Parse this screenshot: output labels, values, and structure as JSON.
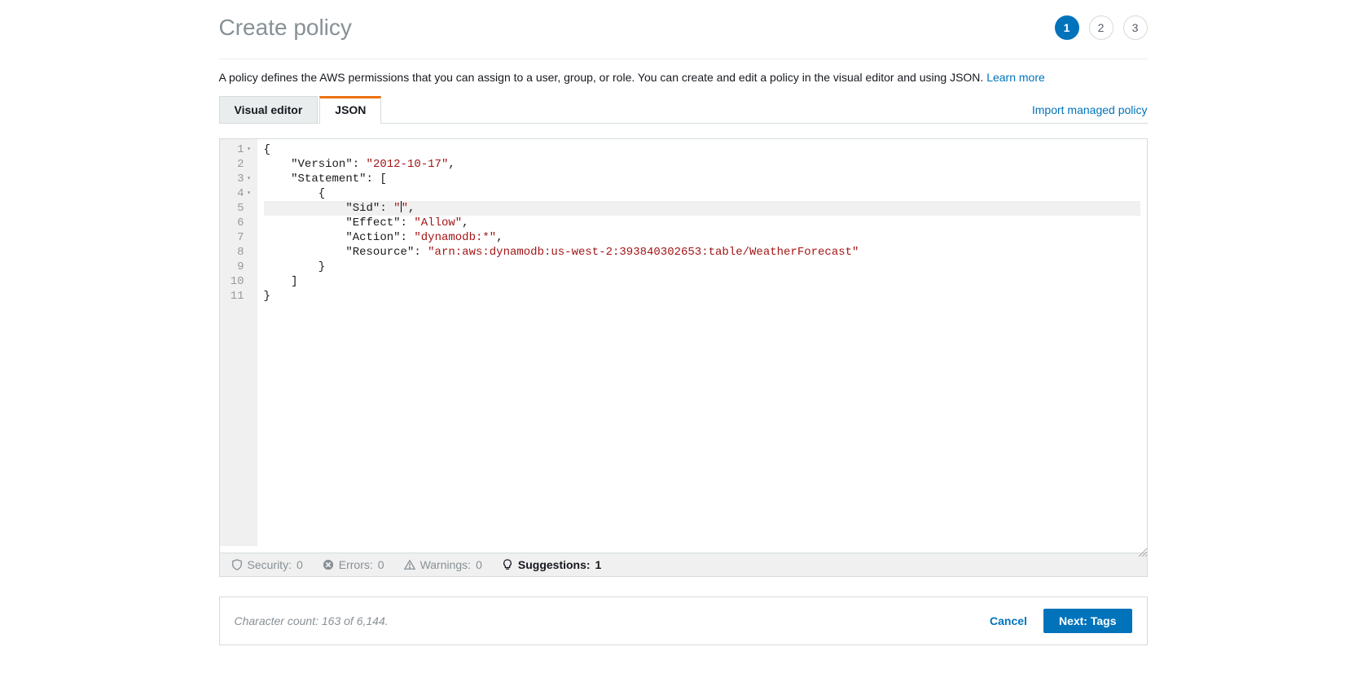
{
  "header": {
    "title": "Create policy",
    "steps": [
      "1",
      "2",
      "3"
    ],
    "active_step": 0
  },
  "description": {
    "text": "A policy defines the AWS permissions that you can assign to a user, group, or role. You can create and edit a policy in the visual editor and using JSON. ",
    "learn_more": "Learn more"
  },
  "tabs": {
    "visual": "Visual editor",
    "json": "JSON",
    "active": "json",
    "import_link": "Import managed policy"
  },
  "editor": {
    "line_numbers": [
      "1",
      "2",
      "3",
      "4",
      "5",
      "6",
      "7",
      "8",
      "9",
      "10",
      "11"
    ],
    "foldable": [
      0,
      2,
      3
    ],
    "highlighted_line": 4,
    "code_lines": [
      {
        "indent": 0,
        "tokens": [
          {
            "t": "{",
            "c": "punc"
          }
        ]
      },
      {
        "indent": 1,
        "tokens": [
          {
            "t": "\"Version\"",
            "c": "key"
          },
          {
            "t": ": ",
            "c": "punc"
          },
          {
            "t": "\"2012-10-17\"",
            "c": "str"
          },
          {
            "t": ",",
            "c": "punc"
          }
        ]
      },
      {
        "indent": 1,
        "tokens": [
          {
            "t": "\"Statement\"",
            "c": "key"
          },
          {
            "t": ": [",
            "c": "punc"
          }
        ]
      },
      {
        "indent": 2,
        "tokens": [
          {
            "t": "{",
            "c": "punc"
          }
        ]
      },
      {
        "indent": 3,
        "tokens": [
          {
            "t": "\"Sid\"",
            "c": "key"
          },
          {
            "t": ": ",
            "c": "punc"
          },
          {
            "t": "\"",
            "c": "str"
          },
          {
            "t": "CURSOR",
            "c": "cursor"
          },
          {
            "t": "\"",
            "c": "str"
          },
          {
            "t": ",",
            "c": "punc"
          }
        ]
      },
      {
        "indent": 3,
        "tokens": [
          {
            "t": "\"Effect\"",
            "c": "key"
          },
          {
            "t": ": ",
            "c": "punc"
          },
          {
            "t": "\"Allow\"",
            "c": "str"
          },
          {
            "t": ",",
            "c": "punc"
          }
        ]
      },
      {
        "indent": 3,
        "tokens": [
          {
            "t": "\"Action\"",
            "c": "key"
          },
          {
            "t": ": ",
            "c": "punc"
          },
          {
            "t": "\"dynamodb:*\"",
            "c": "str"
          },
          {
            "t": ",",
            "c": "punc"
          }
        ]
      },
      {
        "indent": 3,
        "tokens": [
          {
            "t": "\"Resource\"",
            "c": "key"
          },
          {
            "t": ": ",
            "c": "punc"
          },
          {
            "t": "\"arn:aws:dynamodb:us-west-2:393840302653:table/WeatherForecast\"",
            "c": "str"
          }
        ]
      },
      {
        "indent": 2,
        "tokens": [
          {
            "t": "}",
            "c": "punc"
          }
        ]
      },
      {
        "indent": 1,
        "tokens": [
          {
            "t": "]",
            "c": "punc"
          }
        ]
      },
      {
        "indent": 0,
        "tokens": [
          {
            "t": "}",
            "c": "punc"
          }
        ]
      }
    ]
  },
  "status": {
    "security_label": "Security:",
    "security_count": "0",
    "errors_label": "Errors:",
    "errors_count": "0",
    "warnings_label": "Warnings:",
    "warnings_count": "0",
    "suggestions_label": "Suggestions:",
    "suggestions_count": "1"
  },
  "footer": {
    "char_count": "Character count: 163 of 6,144.",
    "cancel": "Cancel",
    "next": "Next: Tags"
  }
}
